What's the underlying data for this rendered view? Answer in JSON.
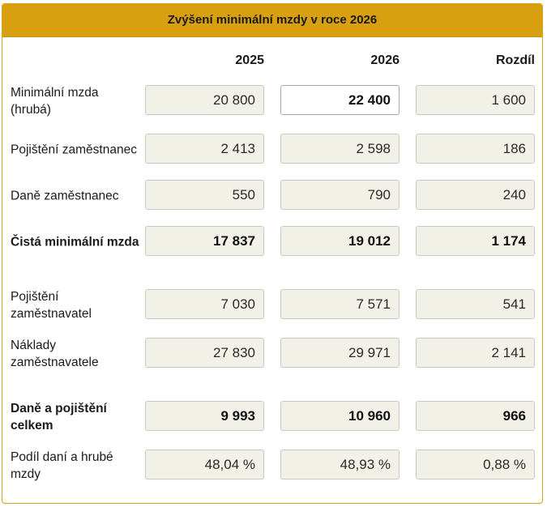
{
  "title": "Zvýšení minimální mzdy v roce 2026",
  "columns": {
    "c2025": "2025",
    "c2026": "2026",
    "diff": "Rozdíl"
  },
  "rows": [
    {
      "label": "Minimální mzda (hrubá)",
      "v2025": "20 800",
      "v2026": "22 400",
      "diff": "1 600"
    },
    {
      "label": "Pojištění zaměstnanec",
      "v2025": "2 413",
      "v2026": "2 598",
      "diff": "186"
    },
    {
      "label": "Daně zaměstnanec",
      "v2025": "550",
      "v2026": "790",
      "diff": "240"
    },
    {
      "label": "Čistá minimální mzda",
      "v2025": "17 837",
      "v2026": "19 012",
      "diff": "1 174"
    },
    {
      "label": "Pojištění zaměstnavatel",
      "v2025": "7 030",
      "v2026": "7 571",
      "diff": "541"
    },
    {
      "label": "Náklady zaměstnavatele",
      "v2025": "27 830",
      "v2026": "29 971",
      "diff": "2 141"
    },
    {
      "label": "Daně a pojištění celkem",
      "v2025": "9 993",
      "v2026": "10 960",
      "diff": "966"
    },
    {
      "label": "Podíl daní a hrubé mzdy",
      "v2025": "48,04 %",
      "v2026": "48,93 %",
      "diff": "0,88 %"
    }
  ]
}
